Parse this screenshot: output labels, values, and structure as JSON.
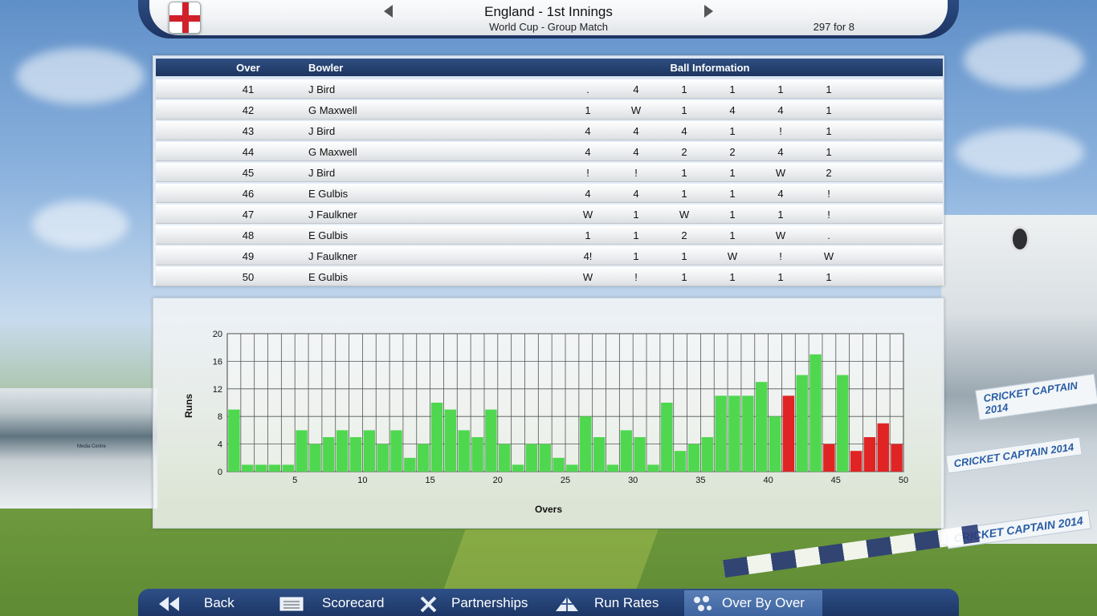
{
  "header": {
    "title": "England - 1st Innings",
    "subtitle": "World Cup - Group Match",
    "score": "297 for 8"
  },
  "scenery": {
    "banner_text": "CRICKET CAPTAIN 2014",
    "media_centre": "Media Centre"
  },
  "table": {
    "headers": {
      "over": "Over",
      "bowler": "Bowler",
      "ball_info": "Ball Information"
    },
    "rows": [
      {
        "over": "41",
        "bowler": "J Bird",
        "balls": [
          ".",
          "4",
          "1",
          "1",
          "1",
          "1"
        ]
      },
      {
        "over": "42",
        "bowler": "G Maxwell",
        "balls": [
          "1",
          "W",
          "1",
          "4",
          "4",
          "1"
        ]
      },
      {
        "over": "43",
        "bowler": "J Bird",
        "balls": [
          "4",
          "4",
          "4",
          "1",
          "!",
          "1"
        ]
      },
      {
        "over": "44",
        "bowler": "G Maxwell",
        "balls": [
          "4",
          "4",
          "2",
          "2",
          "4",
          "1"
        ]
      },
      {
        "over": "45",
        "bowler": "J Bird",
        "balls": [
          "!",
          "!",
          "1",
          "1",
          "W",
          "2"
        ]
      },
      {
        "over": "46",
        "bowler": "E Gulbis",
        "balls": [
          "4",
          "4",
          "1",
          "1",
          "4",
          "!"
        ]
      },
      {
        "over": "47",
        "bowler": "J Faulkner",
        "balls": [
          "W",
          "1",
          "W",
          "1",
          "1",
          "!"
        ]
      },
      {
        "over": "48",
        "bowler": "E Gulbis",
        "balls": [
          "1",
          "1",
          "2",
          "1",
          "W",
          "."
        ]
      },
      {
        "over": "49",
        "bowler": "J Faulkner",
        "balls": [
          "4!",
          "1",
          "1",
          "W",
          "!",
          "W"
        ]
      },
      {
        "over": "50",
        "bowler": "E Gulbis",
        "balls": [
          "W",
          "!",
          "1",
          "1",
          "1",
          "1"
        ]
      }
    ]
  },
  "chart_data": {
    "type": "bar",
    "xlabel": "Overs",
    "ylabel": "Runs",
    "ylim": [
      0,
      20
    ],
    "xlim": [
      0,
      50
    ],
    "y_ticks": [
      0,
      4,
      8,
      12,
      16,
      20
    ],
    "x_ticks": [
      5,
      10,
      15,
      20,
      25,
      30,
      35,
      40,
      45,
      50
    ],
    "grid": true,
    "categories": [
      1,
      2,
      3,
      4,
      5,
      6,
      7,
      8,
      9,
      10,
      11,
      12,
      13,
      14,
      15,
      16,
      17,
      18,
      19,
      20,
      21,
      22,
      23,
      24,
      25,
      26,
      27,
      28,
      29,
      30,
      31,
      32,
      33,
      34,
      35,
      36,
      37,
      38,
      39,
      40,
      41,
      42,
      43,
      44,
      45,
      46,
      47,
      48,
      49,
      50
    ],
    "values": [
      9,
      1,
      1,
      1,
      1,
      6,
      4,
      5,
      6,
      5,
      6,
      4,
      6,
      2,
      4,
      10,
      9,
      6,
      5,
      9,
      4,
      1,
      4,
      4,
      2,
      1,
      8,
      5,
      1,
      6,
      5,
      1,
      10,
      3,
      4,
      5,
      11,
      11,
      11,
      13,
      8,
      11,
      14,
      17,
      4,
      14,
      3,
      5,
      7,
      4
    ],
    "wicket_overs": [
      42,
      45,
      47,
      48,
      49,
      50
    ],
    "colors": {
      "normal": "#4fd84f",
      "wicket": "#e02424"
    }
  },
  "nav": {
    "back": "Back",
    "scorecard": "Scorecard",
    "partnerships": "Partnerships",
    "run_rates": "Run Rates",
    "over_by_over": "Over By Over"
  },
  "icons": {
    "back": "double-left-arrow-icon",
    "scorecard": "scorecard-icon",
    "partnerships": "crossed-bats-icon",
    "run_rates": "run-rates-icon",
    "over_by_over": "cricket-balls-icon"
  }
}
